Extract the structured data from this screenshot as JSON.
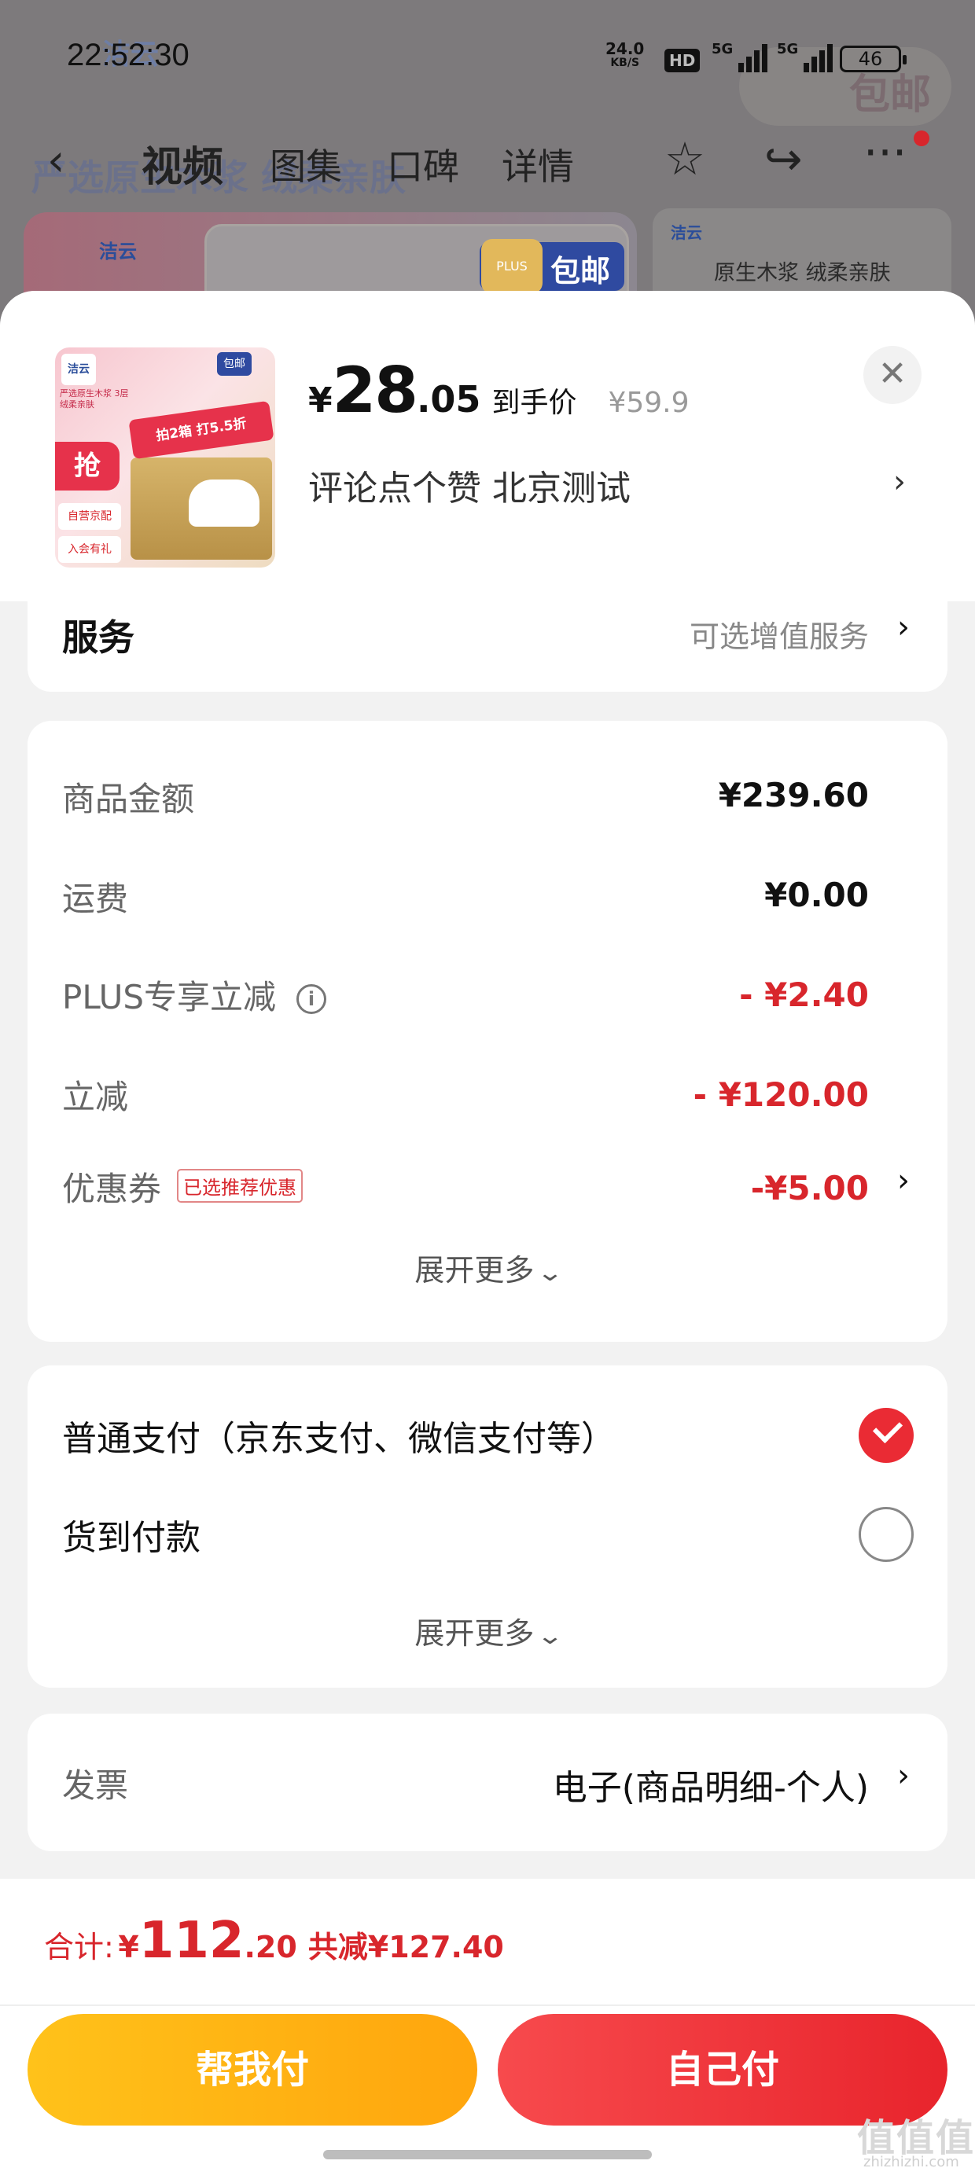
{
  "status_bar": {
    "time": "22:52:30",
    "net_speed": "24.0",
    "net_unit": "KB/S",
    "hd": "HD",
    "sim1": "5G",
    "sim2": "5G",
    "battery": "46"
  },
  "background": {
    "brand": "洁云",
    "faint_text": "严选原生木浆 绒柔亲肤",
    "baoyou_top": "包邮",
    "baoyou_tag": "包邮",
    "plus": "PLUS",
    "logo": "洁云",
    "card_text": "原生木浆 绒柔亲肤"
  },
  "nav": {
    "tabs": [
      "视频",
      "图集",
      "口碑",
      "详情"
    ],
    "active_tab": "视频"
  },
  "product": {
    "price_symbol": "¥",
    "price_int": "28",
    "price_dec": ".05",
    "price_label": "到手价",
    "original_price": "¥59.9",
    "address": "评论点个赞  北京测试",
    "thumb": {
      "logo": "洁云",
      "title": "严选原生木浆 3层绒柔亲肤",
      "qiang": "抢",
      "tag1": "自营京配",
      "tag2": "入会有礼",
      "ribbon": "拍2箱 打5.5折",
      "baoyou": "包邮"
    }
  },
  "service": {
    "title": "服务",
    "value": "可选增值服务"
  },
  "summary": {
    "rows": [
      {
        "label": "商品金额",
        "value": "¥239.60"
      },
      {
        "label": "运费",
        "value": "¥0.00"
      },
      {
        "label": "PLUS专享立减",
        "value": "- ¥2.40"
      },
      {
        "label": "立减",
        "value": "- ¥120.00"
      },
      {
        "label": "优惠券",
        "value": "-¥5.00",
        "tag": "已选推荐优惠"
      }
    ],
    "expand_label": "展开更多"
  },
  "payment": {
    "options": [
      {
        "label": "普通支付（京东支付、微信支付等）",
        "selected": true
      },
      {
        "label": "货到付款",
        "selected": false
      }
    ],
    "expand_label": "展开更多"
  },
  "invoice": {
    "label": "发票",
    "value": "电子(商品明细-个人)"
  },
  "footer": {
    "total_label": "合计:",
    "total_symbol": "¥",
    "total_int": "112",
    "total_dec": ".20",
    "total_saved": "共减¥127.40",
    "help_pay": "帮我付",
    "self_pay": "自己付",
    "watermark": "值值值",
    "watermark_sub": "zhizhizhi.com"
  },
  "colors": {
    "accent_red": "#d8262c",
    "help_btn": "#ffb414",
    "self_btn": "#ef3038"
  }
}
